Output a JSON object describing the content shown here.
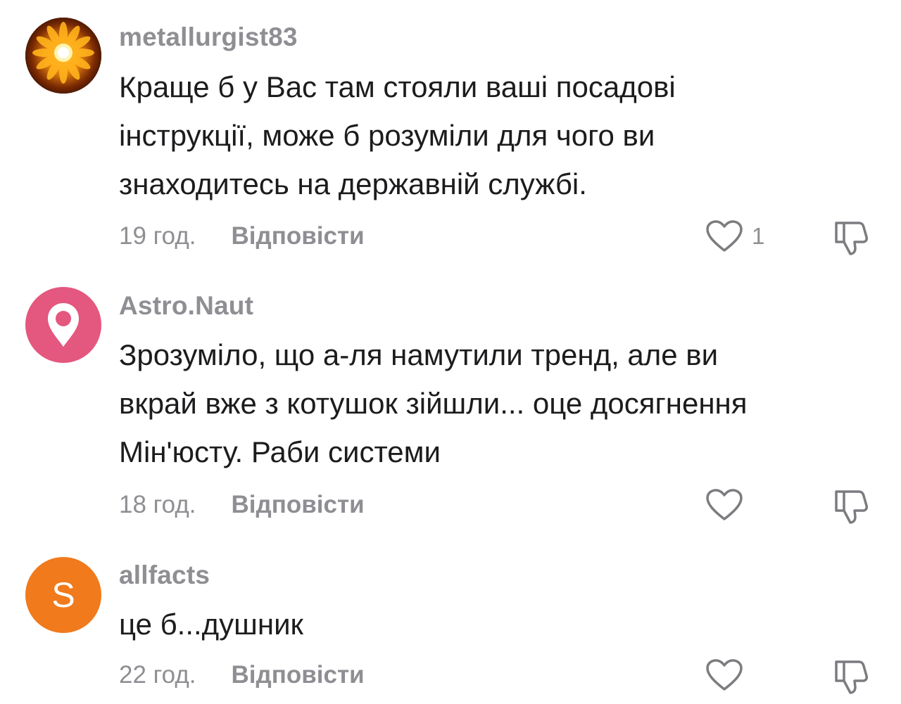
{
  "comments": [
    {
      "username": "metallurgist83",
      "avatar": {
        "type": "photo",
        "icon": "sunflower-photo"
      },
      "lines": [
        "Краще б у Вас там стояли ваші посадові",
        "інструкції, може б розуміли для чого ви",
        "знаходитесь на державній службі."
      ],
      "time": "19 год.",
      "reply_label": "Відповісти",
      "like_count": "1"
    },
    {
      "username": "Astro.Naut",
      "avatar": {
        "type": "icon",
        "icon": "location-pin-icon",
        "color": "#e4577e"
      },
      "lines": [
        "Зрозуміло, що а-ля намутили тренд, але ви",
        "вкрай вже з котушок зійшли... оце досягнення",
        "Мін'юсту. Раби системи"
      ],
      "time": "18 год.",
      "reply_label": "Відповісти",
      "like_count": ""
    },
    {
      "username": "allfacts",
      "avatar": {
        "type": "letter",
        "letter": "S",
        "color": "#f07a1c"
      },
      "lines": [
        "це б...душник"
      ],
      "time": "22 год.",
      "reply_label": "Відповісти",
      "like_count": ""
    }
  ],
  "icons": {
    "like": "heart-outline-icon",
    "dislike": "thumbs-down-outline-icon"
  },
  "colors": {
    "muted_text": "#8e8e93",
    "body_text": "#1c1c1e",
    "icon_stroke": "#7c7c80"
  }
}
